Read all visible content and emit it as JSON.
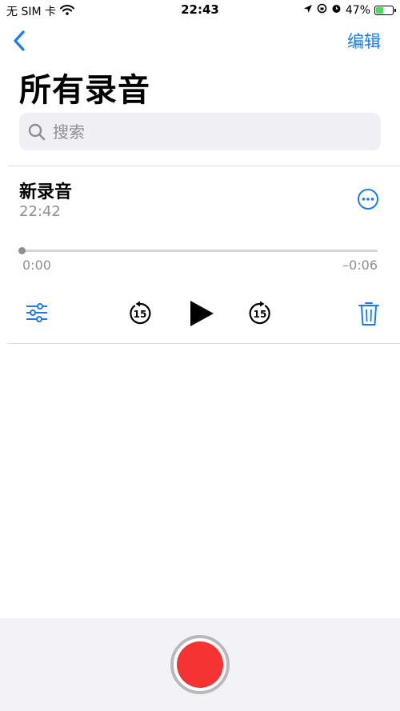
{
  "status_bar": {
    "carrier": "无 SIM 卡",
    "time": "22:43",
    "battery_percent": "47%",
    "battery_level": 0.47
  },
  "nav": {
    "back_icon": "chevron-left-icon",
    "edit_label": "编辑"
  },
  "page": {
    "title": "所有录音"
  },
  "search": {
    "placeholder": "搜索",
    "value": ""
  },
  "recording": {
    "title": "新录音",
    "time": "22:42",
    "elapsed": "0:00",
    "remaining": "–0:06",
    "progress": 0.0
  },
  "controls": {
    "settings_icon": "sliders-icon",
    "skip_back_icon": "skip-back-15-icon",
    "skip_back_seconds": "15",
    "play_icon": "play-icon",
    "skip_forward_icon": "skip-forward-15-icon",
    "skip_forward_seconds": "15",
    "delete_icon": "trash-icon"
  },
  "record": {
    "icon": "record-icon"
  },
  "colors": {
    "accent": "#1a7cf0",
    "record_red": "#f53333",
    "battery_green": "#4cd964",
    "secondary_text": "#8e8e93"
  }
}
